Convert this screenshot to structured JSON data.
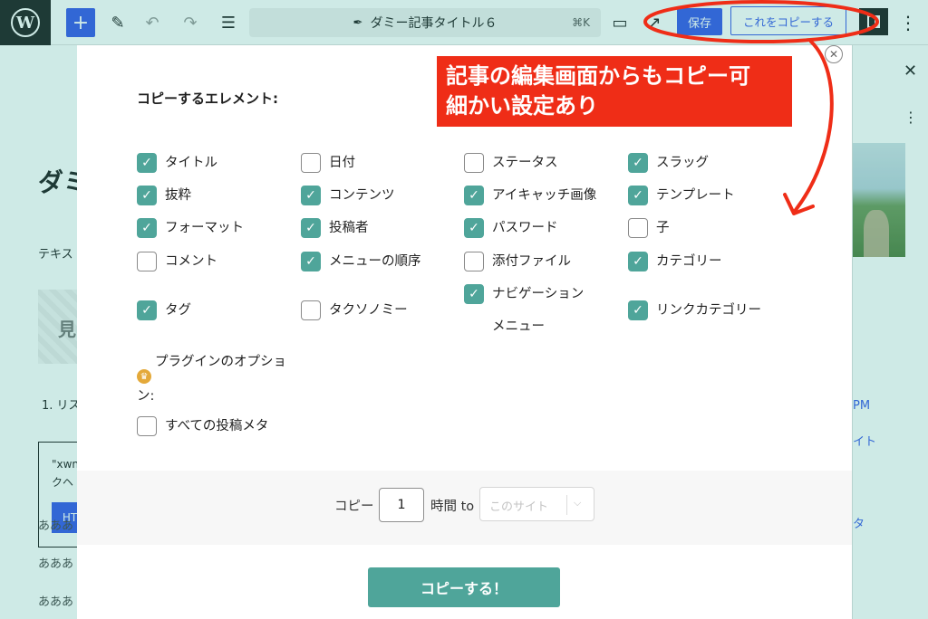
{
  "topbar": {
    "logo": "W",
    "add_label": "+",
    "doc_title": "ダミー記事タイトル６",
    "shortcut": "⌘K",
    "save_label": "保存",
    "copy_this_label": "これをコピーする"
  },
  "editor_bg": {
    "title_fragment": "ダミ",
    "text_fragment": "テキス",
    "heading_fragment": "見",
    "list_fragment": "1. リス",
    "code_line1": "\"xwn",
    "code_line2": "クヘ",
    "html_button": "HT",
    "paragraphs": [
      "あああ",
      "あああ",
      "あああ"
    ]
  },
  "sidebar_bg": {
    "time_fragment": "PM",
    "site_fragment": "イト",
    "meta_fragment": "タ"
  },
  "modal": {
    "heading": "コピーするエレメント:",
    "options": [
      {
        "label": "タイトル",
        "checked": true
      },
      {
        "label": "日付",
        "checked": false
      },
      {
        "label": "ステータス",
        "checked": false
      },
      {
        "label": "スラッグ",
        "checked": true
      },
      {
        "label": "抜粋",
        "checked": true
      },
      {
        "label": "コンテンツ",
        "checked": true
      },
      {
        "label": "アイキャッチ画像",
        "checked": true
      },
      {
        "label": "テンプレート",
        "checked": true
      },
      {
        "label": "フォーマット",
        "checked": true
      },
      {
        "label": "投稿者",
        "checked": true
      },
      {
        "label": "パスワード",
        "checked": true
      },
      {
        "label": "子",
        "checked": false
      },
      {
        "label": "コメント",
        "checked": false
      },
      {
        "label": "メニューの順序",
        "checked": true
      },
      {
        "label": "添付ファイル",
        "checked": false
      },
      {
        "label": "カテゴリー",
        "checked": true
      },
      {
        "label": "タグ",
        "checked": true
      },
      {
        "label": "タクソノミー",
        "checked": false
      },
      {
        "label": "ナビゲーションメニュー",
        "checked": true
      },
      {
        "label": "リンクカテゴリー",
        "checked": true
      }
    ],
    "plugin_options_line1": "プラグインのオプショ",
    "plugin_options_line2": "ン:",
    "all_meta": {
      "label": "すべての投稿メタ",
      "checked": false
    },
    "footer": {
      "copy_label": "コピー",
      "count_value": "1",
      "times_to_label": "時間 to",
      "site_placeholder": "このサイト"
    },
    "submit_label": "コピーする！"
  },
  "annotation": {
    "line1": "記事の編集画面からもコピー可",
    "line2": "細かい設定あり",
    "color": "#ef2d17"
  }
}
